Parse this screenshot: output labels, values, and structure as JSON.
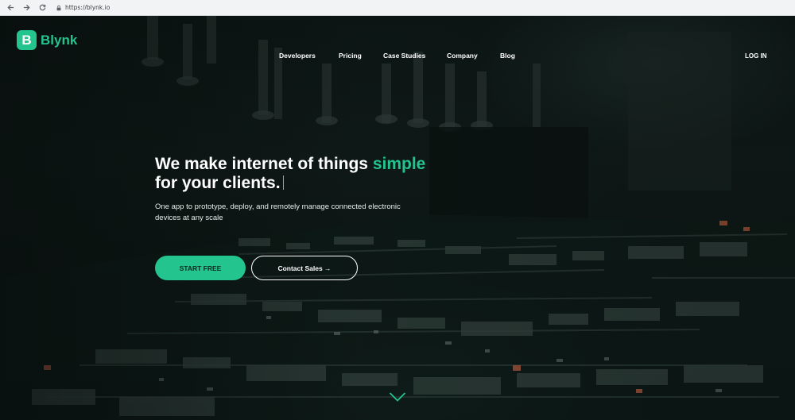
{
  "browser": {
    "url": "https://blynk.io"
  },
  "header": {
    "logo_letter": "B",
    "logo_text": "Blynk",
    "nav": [
      {
        "label": "Developers"
      },
      {
        "label": "Pricing"
      },
      {
        "label": "Case Studies"
      },
      {
        "label": "Company"
      },
      {
        "label": "Blog"
      }
    ],
    "login_label": "LOG IN"
  },
  "hero": {
    "headline_part1": "We make internet of things ",
    "headline_accent": "simple",
    "headline_part2": "for your clients.",
    "subtitle": "One app to prototype, deploy, and remotely manage connected electronic devices at any scale",
    "primary_button": "START FREE",
    "secondary_button": "Contact Sales →"
  },
  "colors": {
    "accent": "#23c48e",
    "background": "#0d1715"
  },
  "icons": {
    "back": "arrow-left-icon",
    "forward": "arrow-right-icon",
    "reload": "reload-icon",
    "lock": "lock-icon",
    "scroll": "chevron-down-icon"
  }
}
